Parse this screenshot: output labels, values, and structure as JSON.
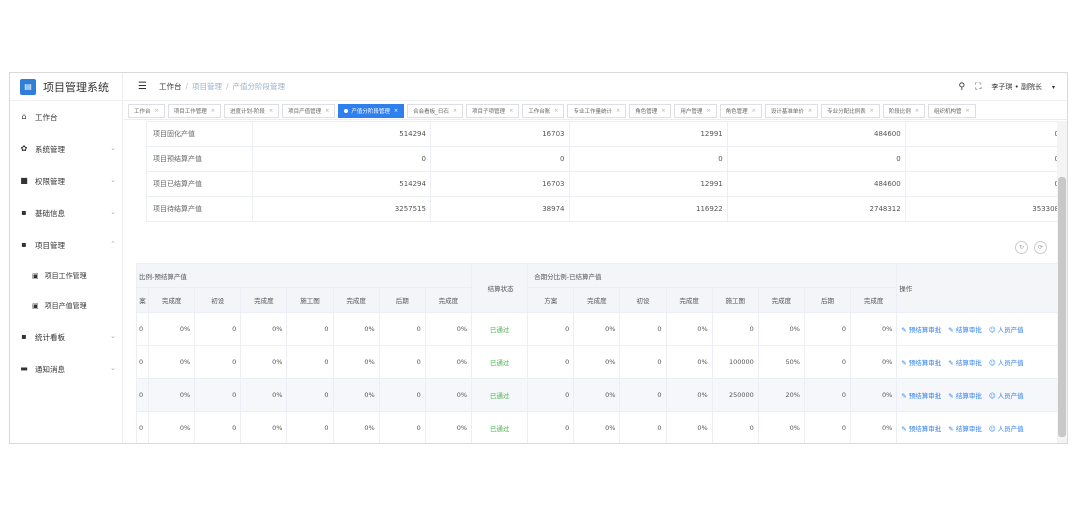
{
  "sidebar": {
    "brand": "项目管理系统",
    "items": [
      {
        "label": "工作台",
        "icon": "home-icon"
      },
      {
        "label": "系统管理",
        "icon": "gear-icon"
      },
      {
        "label": "权限管理",
        "icon": "lock-icon"
      },
      {
        "label": "基础信息",
        "icon": "list-icon"
      },
      {
        "label": "项目管理",
        "icon": "folder-icon"
      }
    ],
    "sub_items": [
      {
        "label": "项目工作管理"
      },
      {
        "label": "项目产值管理"
      }
    ],
    "items_after": [
      {
        "label": "统计看板",
        "icon": "chart-icon"
      },
      {
        "label": "通知消息",
        "icon": "message-icon"
      }
    ]
  },
  "header": {
    "breadcrumb": [
      "工作台",
      "项目管理",
      "产值分阶段管理"
    ],
    "user": "李子琪 • 副院长"
  },
  "tabs": [
    {
      "label": "工作台",
      "active": false
    },
    {
      "label": "项目工作管理",
      "active": false
    },
    {
      "label": "进度计划-阶段",
      "active": false
    },
    {
      "label": "项目产值管理",
      "active": false
    },
    {
      "label": "产值分阶段管理",
      "active": true
    },
    {
      "label": "合会看板_日石",
      "active": false
    },
    {
      "label": "项目子项管理",
      "active": false
    },
    {
      "label": "工作台账",
      "active": false
    },
    {
      "label": "专业工作量统计",
      "active": false
    },
    {
      "label": "角色管理",
      "active": false
    },
    {
      "label": "用户管理",
      "active": false
    },
    {
      "label": "角色管理",
      "active": false
    },
    {
      "label": "设计基准单价",
      "active": false
    },
    {
      "label": "专业分配比例表",
      "active": false
    },
    {
      "label": "阶段比例",
      "active": false
    },
    {
      "label": "组织机构管",
      "active": false
    }
  ],
  "summary": {
    "rows": [
      {
        "label": "项目固化产值",
        "values": [
          "514294",
          "16703",
          "12991",
          "484600",
          "0"
        ]
      },
      {
        "label": "项目预结算产值",
        "values": [
          "0",
          "0",
          "0",
          "0",
          "0"
        ]
      },
      {
        "label": "项目已结算产值",
        "values": [
          "514294",
          "16703",
          "12991",
          "484600",
          "0"
        ]
      },
      {
        "label": "项目待结算产值",
        "values": [
          "3257515",
          "38974",
          "116922",
          "2748312",
          "353308"
        ]
      }
    ]
  },
  "detail": {
    "group_left": "比例-预结算产值",
    "group_status": "结算状态",
    "group_right": "合期分比例-已结算产值",
    "group_ops": "操作",
    "left_cols": [
      "案",
      "完成度",
      "初设",
      "完成度",
      "施工图",
      "完成度",
      "后期",
      "完成度"
    ],
    "right_cols": [
      "方案",
      "完成度",
      "初设",
      "完成度",
      "施工图",
      "完成度",
      "后期",
      "完成度"
    ],
    "op_labels": [
      "预结算审批",
      "结算审批",
      "人员产值"
    ],
    "rows": [
      {
        "left": [
          "0",
          "0%",
          "0",
          "0%",
          "0",
          "0%",
          "0",
          "0%"
        ],
        "status": "已通过",
        "right": [
          "0",
          "0%",
          "0",
          "0%",
          "0",
          "0%",
          "0",
          "0%"
        ]
      },
      {
        "left": [
          "0",
          "0%",
          "0",
          "0%",
          "0",
          "0%",
          "0",
          "0%"
        ],
        "status": "已通过",
        "right": [
          "0",
          "0%",
          "0",
          "0%",
          "100000",
          "50%",
          "0",
          "0%"
        ]
      },
      {
        "left": [
          "0",
          "0%",
          "0",
          "0%",
          "0",
          "0%",
          "0",
          "0%"
        ],
        "status": "已通过",
        "right": [
          "0",
          "0%",
          "0",
          "0%",
          "250000",
          "20%",
          "0",
          "0%"
        ]
      },
      {
        "left": [
          "0",
          "0%",
          "0",
          "0%",
          "0",
          "0%",
          "0",
          "0%"
        ],
        "status": "已通过",
        "right": [
          "0",
          "0%",
          "0",
          "0%",
          "0",
          "0%",
          "0",
          "0%"
        ]
      }
    ]
  }
}
